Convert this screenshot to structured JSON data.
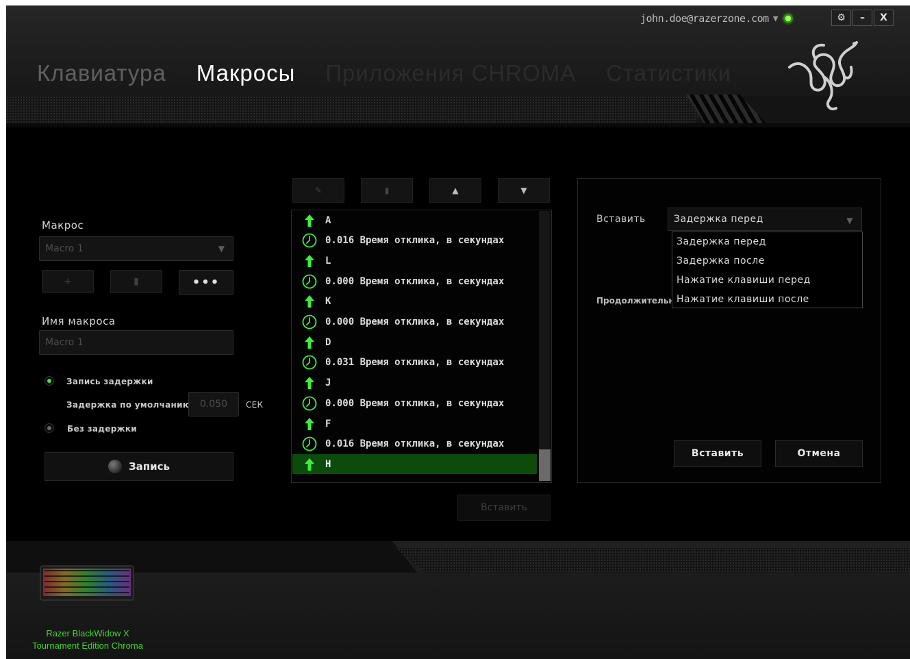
{
  "header": {
    "account_email": "john.doe@razerzone.com",
    "window_controls": {
      "settings": "⚙",
      "minimize": "–",
      "close": "X"
    },
    "tabs": [
      {
        "label": "Клавиатура",
        "state": "inactive"
      },
      {
        "label": "Макросы",
        "state": "active"
      },
      {
        "label": "Приложения CHROMA",
        "state": "dim"
      },
      {
        "label": "Статистики",
        "state": "dim"
      }
    ]
  },
  "left_panel": {
    "macro_label": "Макрос",
    "macro_select_value": "Macro 1",
    "macro_name_label": "Имя макроса",
    "macro_name_value": "Macro 1",
    "record_delay_label": "Запись задержки",
    "default_delay_label": "Задержка по умолчанию",
    "default_delay_value": "0.050",
    "delay_unit": "СЕК",
    "no_delay_label": "Без задержки",
    "record_button": "Запись",
    "more_button": "•••"
  },
  "center_panel": {
    "events": [
      {
        "type": "key",
        "text": "A"
      },
      {
        "type": "delay",
        "text": "0.016 Время отклика, в секундах"
      },
      {
        "type": "key",
        "text": "L"
      },
      {
        "type": "delay",
        "text": "0.000 Время отклика, в секундах"
      },
      {
        "type": "key",
        "text": "K"
      },
      {
        "type": "delay",
        "text": "0.000 Время отклика, в секундах"
      },
      {
        "type": "key",
        "text": "D"
      },
      {
        "type": "delay",
        "text": "0.031 Время отклика, в секундах"
      },
      {
        "type": "key",
        "text": "J"
      },
      {
        "type": "delay",
        "text": "0.000 Время отклика, в секундах"
      },
      {
        "type": "key",
        "text": "F"
      },
      {
        "type": "delay",
        "text": "0.016 Время отклика, в секундах"
      },
      {
        "type": "key",
        "text": "H",
        "selected": true
      }
    ],
    "insert_button": "Вставить"
  },
  "right_panel": {
    "insert_label": "Вставить",
    "insert_select_value": "Задержка перед",
    "options": [
      "Задержка перед",
      "Задержка после",
      "Нажатие клавиши перед",
      "Нажатие клавиши после"
    ],
    "duration_label": "Продолжительность",
    "insert_button": "Вставить",
    "cancel_button": "Отмена"
  },
  "footer": {
    "device_name_line1": "Razer BlackWidow X",
    "device_name_line2": "Tournament Edition Chroma"
  },
  "colors": {
    "accent_green": "#44d62c",
    "selected_row": "#0b4c0a",
    "background": "#000000"
  }
}
